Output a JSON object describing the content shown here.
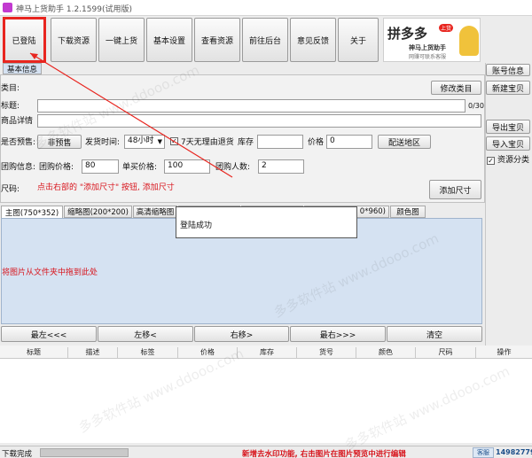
{
  "window": {
    "title": "神马上货助手 1.2.1599(试用版)"
  },
  "toolbar": {
    "buttons": [
      "已登陆",
      "下载资源",
      "一键上货",
      "基本设置",
      "查看资源",
      "前往后台",
      "意见反馈",
      "关于"
    ]
  },
  "banner": {
    "brand": "拼多多",
    "sub": "神马上货助手",
    "tag": "上货",
    "note": "网赚可联系客服"
  },
  "section_tab": "基本信息",
  "right_panel": {
    "account": "账号信息",
    "new_item": "新建宝贝",
    "export": "导出宝贝",
    "import": "导入宝贝",
    "resource_category": "资源分类"
  },
  "form": {
    "category_label": "类目:",
    "modify_category": "修改类目",
    "title_label": "标题:",
    "title_counter": "0/30",
    "detail_label": "商品详情",
    "presale_label": "是否预售:",
    "non_presale": "非预售",
    "ship_time_label": "发货时间:",
    "ship_time_value": "48小时",
    "no_reason_return": "7天无理由退货",
    "stock_label": "库存",
    "price_label": "价格",
    "price_value": "0",
    "delivery_region": "配送地区",
    "group_info_label": "团购信息:",
    "group_price_label": "团购价格:",
    "group_price_value": "80",
    "single_price_label": "单买价格:",
    "single_price_value": "100",
    "group_count_label": "团购人数:",
    "group_count_value": "2",
    "size_label": "尺码:",
    "size_hint": "点击右部的 \"添加尺寸\" 按钮, 添加尺寸",
    "add_size": "添加尺寸"
  },
  "image_tabs": [
    "主图(750*352)",
    "缩略图(200*200)",
    "高清缩略图",
    "",
    "",
    "0*960)",
    "颜色图"
  ],
  "popup": {
    "message": "登陆成功"
  },
  "drop_hint": "将图片从文件夹中拖到此处",
  "nav_buttons": [
    "最左<<<",
    "左移<",
    "右移>",
    "最右>>>",
    "清空"
  ],
  "table_headers": [
    "标题",
    "描述",
    "标签",
    "价格",
    "库存",
    "货号",
    "颜色",
    "尺码",
    "操作"
  ],
  "status": {
    "text": "下载完成",
    "notice": "新增去水印功能, 右击图片在图片预览中进行编辑",
    "qq_label": "客服QQ",
    "qq_number": "149827790"
  },
  "watermark": "多多软件站 www.ddooo.com",
  "colors": {
    "highlight": "#e8251f",
    "notice": "#d8141c",
    "tab_active": "#d5e2f2"
  }
}
